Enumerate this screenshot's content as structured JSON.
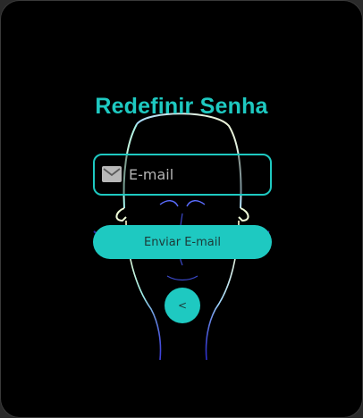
{
  "page": {
    "title": "Redefinir Senha"
  },
  "form": {
    "email_placeholder": "E-mail",
    "email_value": "",
    "email_icon": "mail-icon",
    "submit_label": "Enviar E-mail",
    "back_label": "<"
  },
  "colors": {
    "accent": "#1ec9c1",
    "background": "#000000",
    "button_text": "#1c3a38"
  }
}
